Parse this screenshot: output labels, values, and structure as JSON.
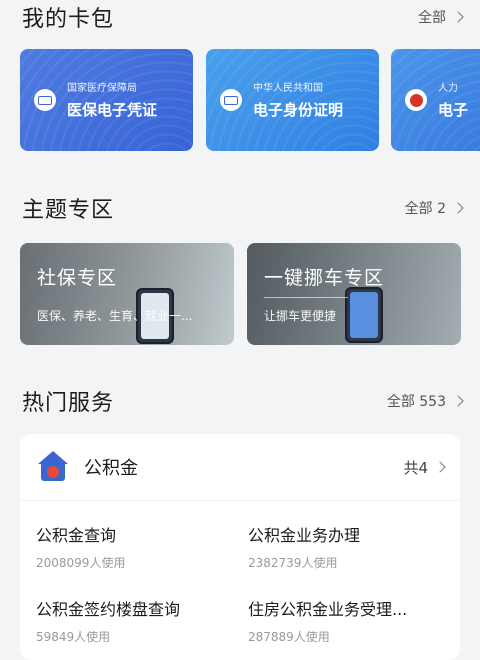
{
  "sections": {
    "cards": {
      "title": "我的卡包",
      "more": "全部"
    },
    "themes": {
      "title": "主题专区",
      "more": "全部 2"
    },
    "hot": {
      "title": "热门服务",
      "more": "全部 553"
    }
  },
  "cards": [
    {
      "issuer": "国家医疗保障局",
      "name": "医保电子凭证",
      "icon": "medical-insurance-icon"
    },
    {
      "issuer": "中华人民共和国",
      "name": "电子身份证明",
      "icon": "id-card-icon"
    },
    {
      "issuer": "人力",
      "name": "电子",
      "icon": "social-security-emblem-icon"
    }
  ],
  "themes": [
    {
      "title": "社保专区",
      "subtitle": "医保、养老、生育、就业一..."
    },
    {
      "title": "一键挪车专区",
      "subtitle": "让挪车更便捷"
    }
  ],
  "hot_service": {
    "name": "公积金",
    "icon": "house-fund-icon",
    "count": "共4",
    "items": [
      {
        "title": "公积金查询",
        "usage": "2008099人使用"
      },
      {
        "title": "公积金业务办理",
        "usage": "2382739人使用"
      },
      {
        "title": "公积金签约楼盘查询",
        "usage": "59849人使用"
      },
      {
        "title": "住房公积金业务受理...",
        "usage": "287889人使用"
      }
    ]
  }
}
